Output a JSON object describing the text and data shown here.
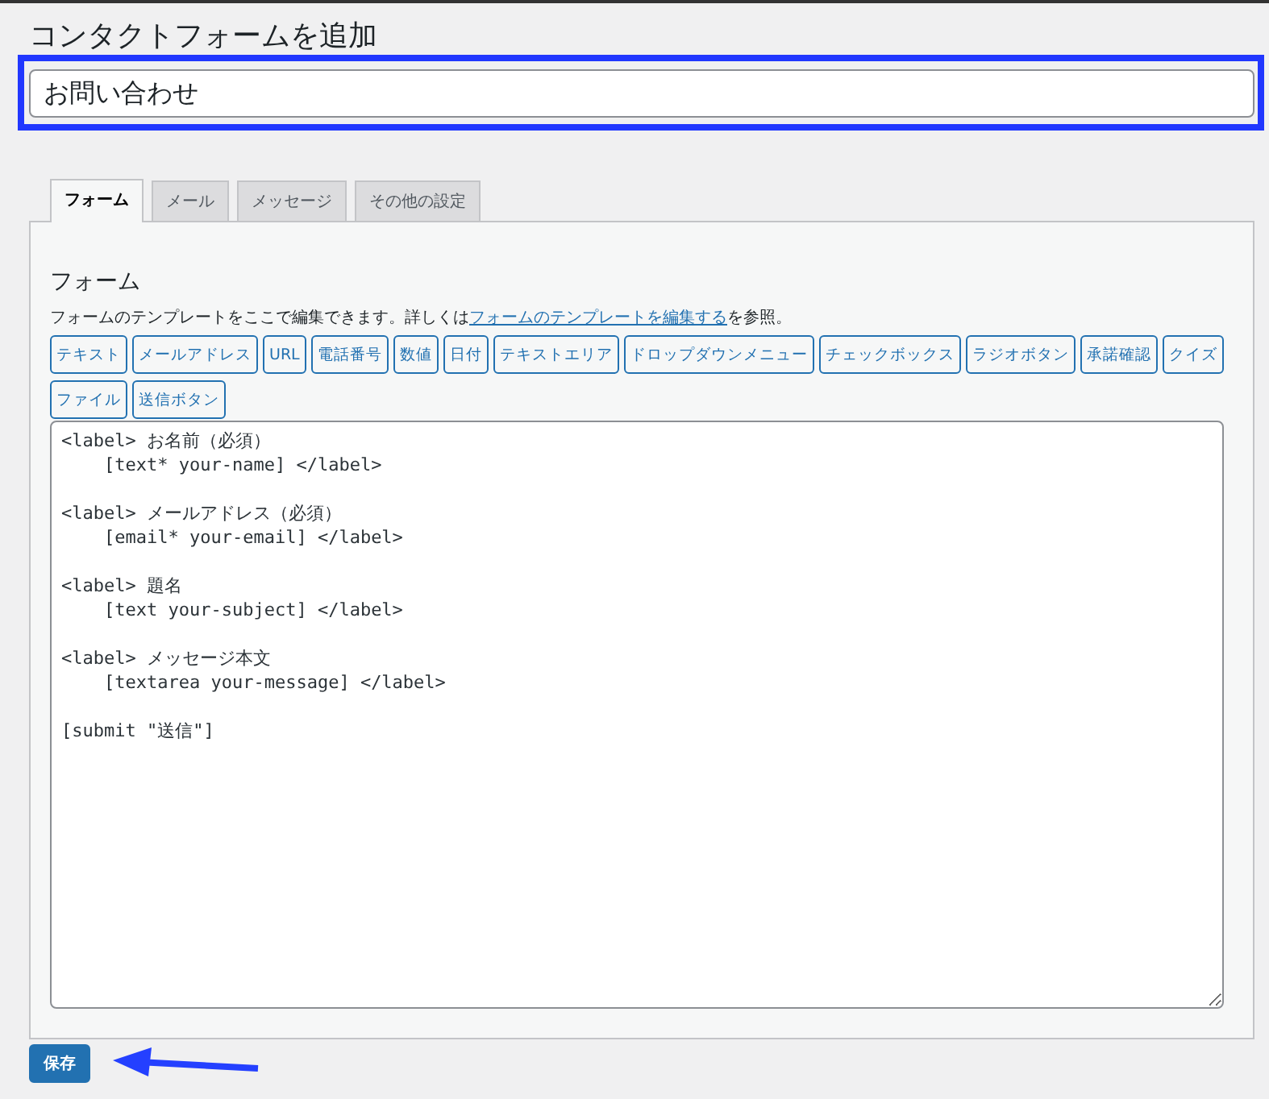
{
  "page_title": "コンタクトフォームを追加",
  "title_field": {
    "value": "お問い合わせ"
  },
  "tabs": [
    {
      "label": "フォーム",
      "selected": true
    },
    {
      "label": "メール",
      "selected": false
    },
    {
      "label": "メッセージ",
      "selected": false
    },
    {
      "label": "その他の設定",
      "selected": false
    }
  ],
  "form_panel": {
    "heading": "フォーム",
    "description_before": "フォームのテンプレートをここで編集できます。詳しくは",
    "description_link": "フォームのテンプレートを編集する",
    "description_after": "を参照。",
    "tag_buttons": [
      "テキスト",
      "メールアドレス",
      "URL",
      "電話番号",
      "数値",
      "日付",
      "テキストエリア",
      "ドロップダウンメニュー",
      "チェックボックス",
      "ラジオボタン",
      "承諾確認",
      "クイズ",
      "ファイル",
      "送信ボタン"
    ],
    "template": "<label> お名前（必須）\n    [text* your-name] </label>\n\n<label> メールアドレス（必須）\n    [email* your-email] </label>\n\n<label> 題名\n    [text your-subject] </label>\n\n<label> メッセージ本文\n    [textarea your-message] </label>\n\n[submit \"送信\"]"
  },
  "save_button": "保存"
}
